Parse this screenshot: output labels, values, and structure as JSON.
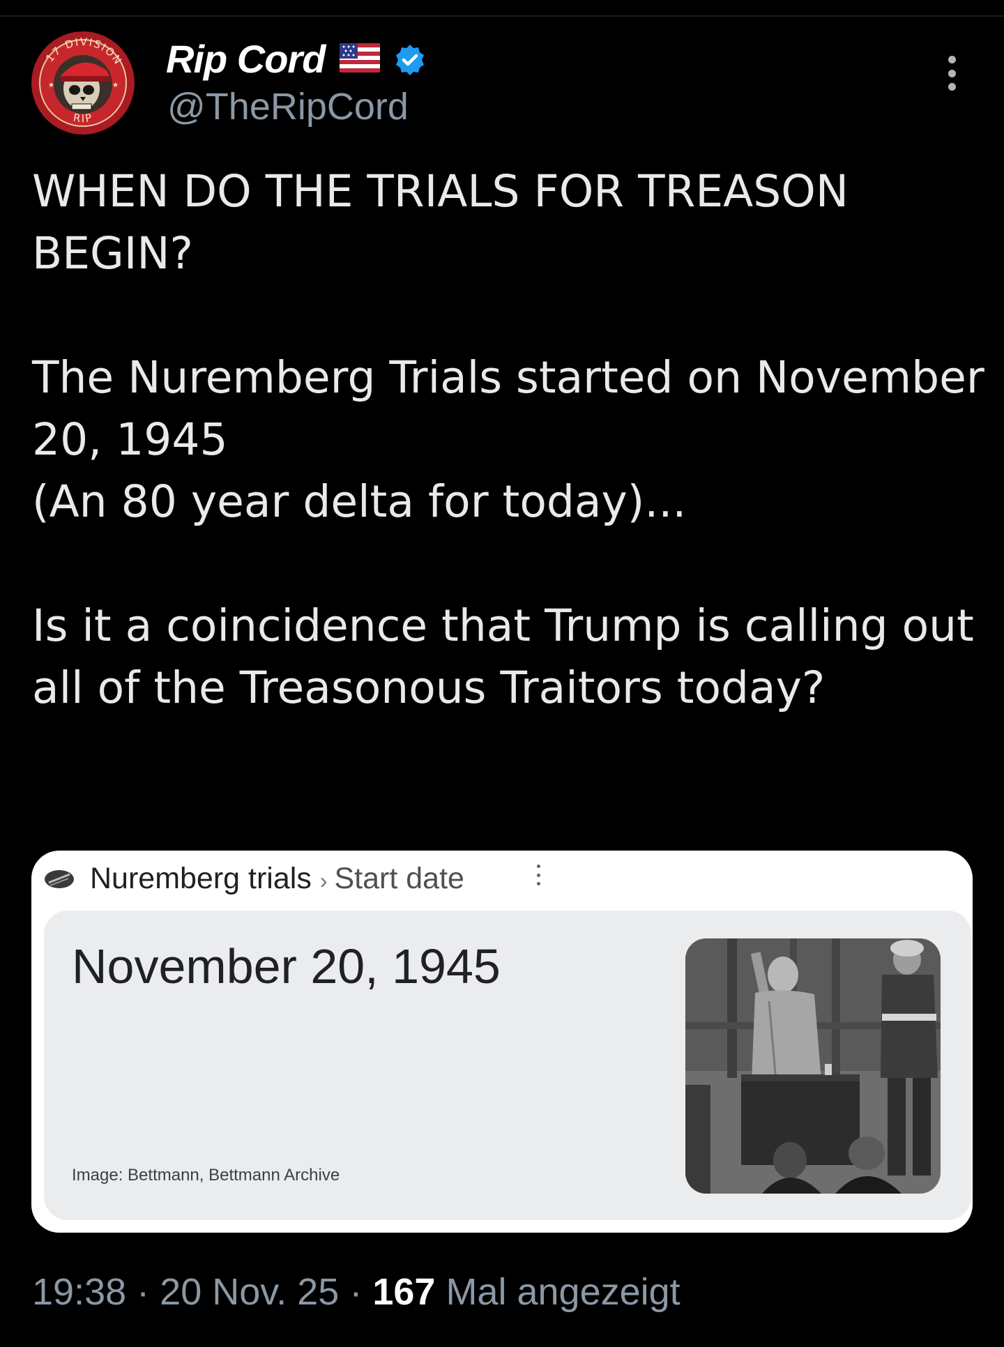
{
  "tweet": {
    "display_name": "Rip Cord",
    "flag_icon": "us-flag-emoji",
    "verified_icon": "verified-badge-blue",
    "handle": "@TheRipCord",
    "avatar": {
      "top_text": "17 DIVISION",
      "bottom_text": "RIP"
    },
    "text": {
      "line1": "WHEN DO THE TRIALS FOR TREASON",
      "line2": "BEGIN?",
      "line3": "The Nuremberg Trials started on November",
      "line4": "20, 1945",
      "line5": "(An 80 year delta for today)...",
      "line6": "Is it a coincidence that Trump is calling out",
      "line7": "all of the Treasonous Traitors today?"
    },
    "card": {
      "source_icon": "search-source-icon",
      "breadcrumb_1": "Nuremberg trials",
      "breadcrumb_separator": "›",
      "breadcrumb_2": "Start date",
      "answer": "November 20, 1945",
      "image_credit": "Image: Bettmann, Bettmann Archive"
    },
    "meta": {
      "time": "19:38",
      "separator": "·",
      "date": "20 Nov. 25",
      "views_count": "167",
      "views_label": "Mal angezeigt"
    }
  },
  "colors": {
    "background": "#000000",
    "text_primary": "#e7e9ea",
    "text_secondary": "#8b98a5",
    "verified_blue": "#1d9bf0",
    "card_background": "#ffffff",
    "answer_panel": "#ebecee"
  }
}
